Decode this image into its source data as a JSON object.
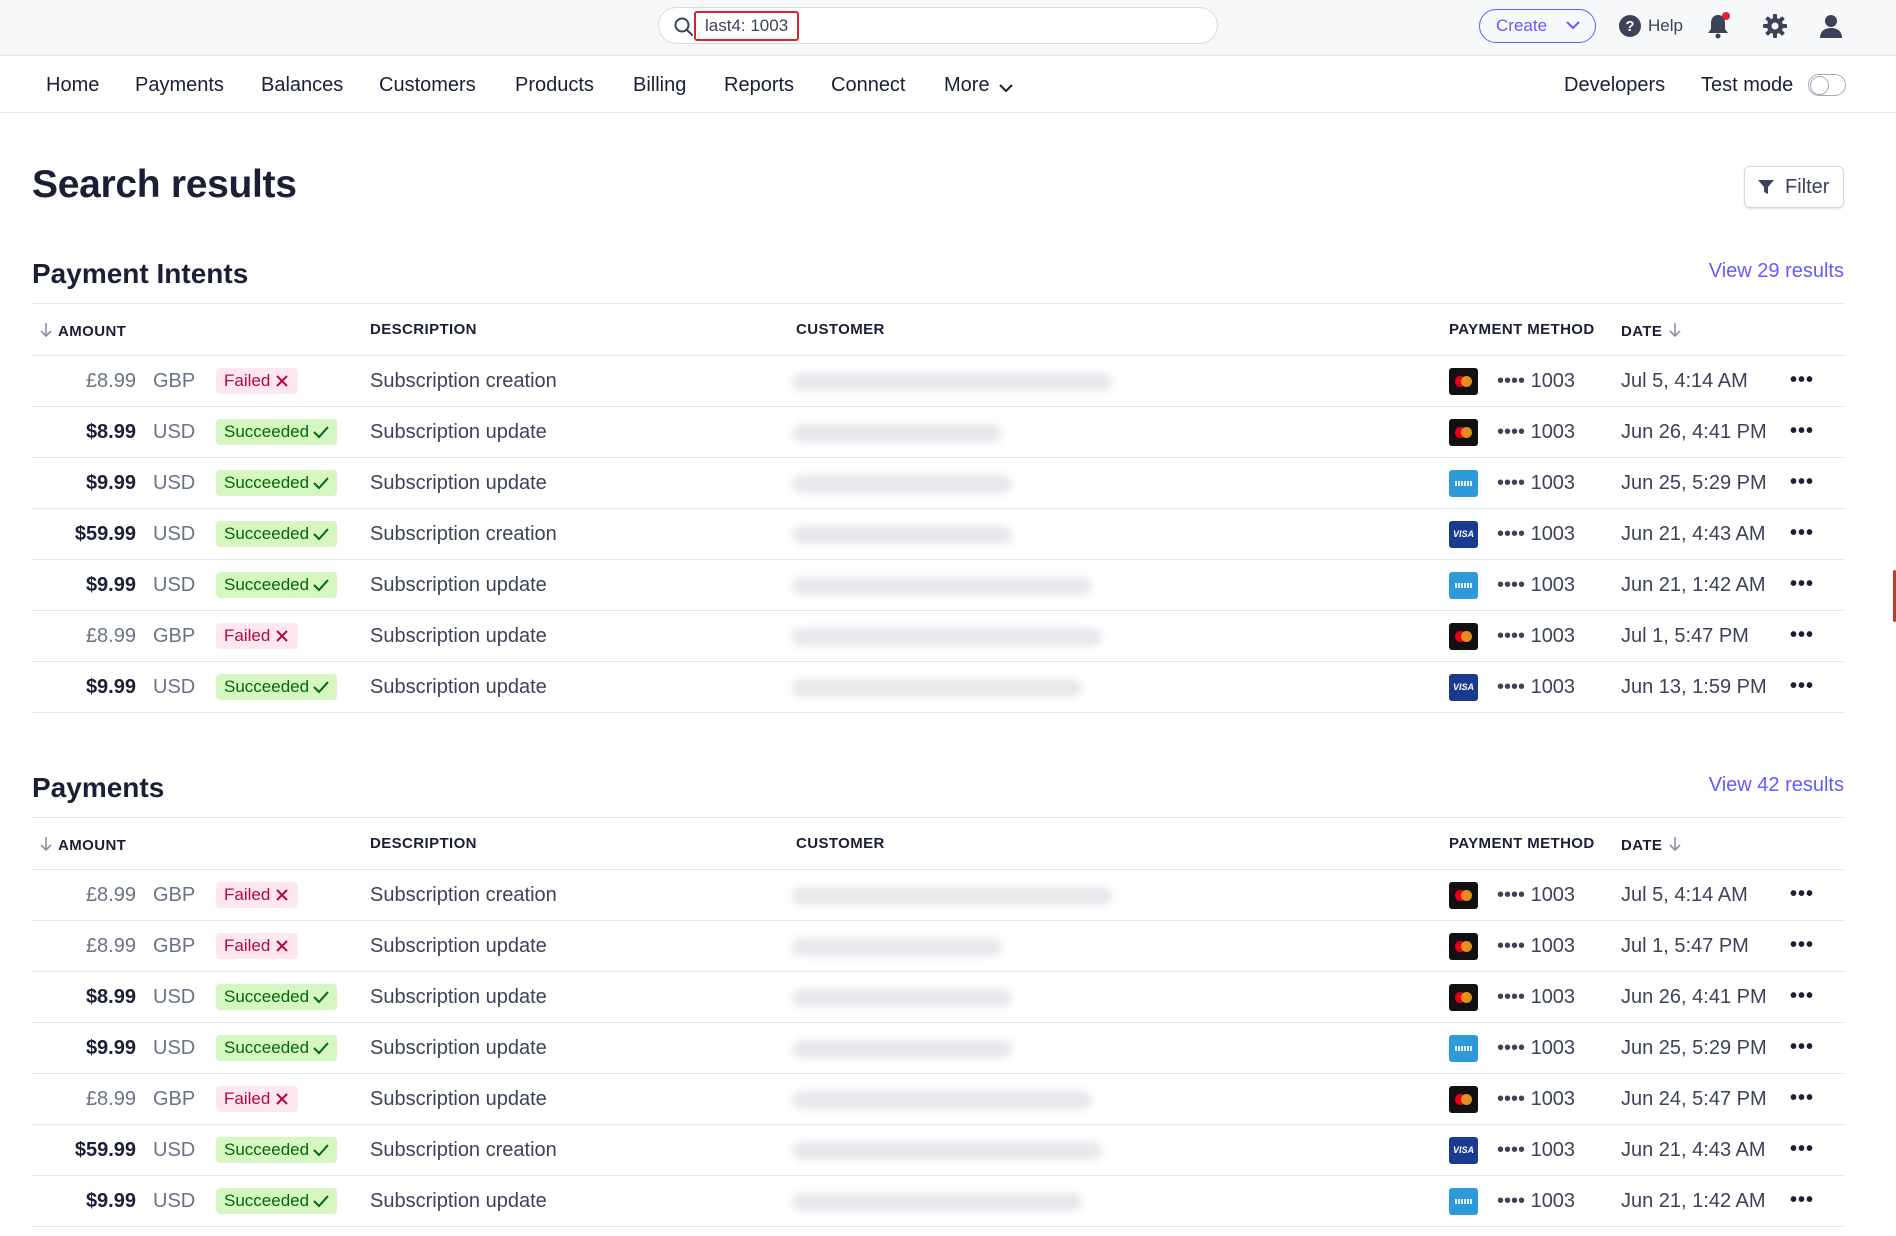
{
  "search": {
    "query": "last4: 1003"
  },
  "topbar": {
    "create_label": "Create",
    "help_label": "Help"
  },
  "nav": {
    "items": [
      "Home",
      "Payments",
      "Balances",
      "Customers",
      "Products",
      "Billing",
      "Reports",
      "Connect",
      "More"
    ],
    "developers": "Developers",
    "test_mode": "Test mode",
    "test_mode_on": false
  },
  "page": {
    "title": "Search results",
    "filter_label": "Filter"
  },
  "columns": {
    "amount": "AMOUNT",
    "description": "DESCRIPTION",
    "customer": "CUSTOMER",
    "payment_method": "PAYMENT METHOD",
    "date": "DATE"
  },
  "payment_intents": {
    "title": "Payment Intents",
    "view_link": "View 29 results",
    "rows": [
      {
        "amount": "£8.99",
        "currency": "GBP",
        "status": "Failed",
        "status_type": "fail",
        "description": "Subscription creation",
        "card": "mastercard",
        "last4": "•••• 1003",
        "date": "Jul 5, 4:14 AM"
      },
      {
        "amount": "$8.99",
        "currency": "USD",
        "status": "Succeeded",
        "status_type": "succ",
        "description": "Subscription update",
        "card": "mastercard",
        "last4": "•••• 1003",
        "date": "Jun 26, 4:41 PM"
      },
      {
        "amount": "$9.99",
        "currency": "USD",
        "status": "Succeeded",
        "status_type": "succ",
        "description": "Subscription update",
        "card": "amex",
        "last4": "•••• 1003",
        "date": "Jun 25, 5:29 PM"
      },
      {
        "amount": "$59.99",
        "currency": "USD",
        "status": "Succeeded",
        "status_type": "succ",
        "description": "Subscription creation",
        "card": "visa",
        "last4": "•••• 1003",
        "date": "Jun 21, 4:43 AM"
      },
      {
        "amount": "$9.99",
        "currency": "USD",
        "status": "Succeeded",
        "status_type": "succ",
        "description": "Subscription update",
        "card": "amex",
        "last4": "•••• 1003",
        "date": "Jun 21, 1:42 AM"
      },
      {
        "amount": "£8.99",
        "currency": "GBP",
        "status": "Failed",
        "status_type": "fail",
        "description": "Subscription update",
        "card": "mastercard",
        "last4": "•••• 1003",
        "date": "Jul 1, 5:47 PM"
      },
      {
        "amount": "$9.99",
        "currency": "USD",
        "status": "Succeeded",
        "status_type": "succ",
        "description": "Subscription update",
        "card": "visa",
        "last4": "•••• 1003",
        "date": "Jun 13, 1:59 PM"
      }
    ]
  },
  "payments": {
    "title": "Payments",
    "view_link": "View 42 results",
    "rows": [
      {
        "amount": "£8.99",
        "currency": "GBP",
        "status": "Failed",
        "status_type": "fail",
        "description": "Subscription creation",
        "card": "mastercard",
        "last4": "•••• 1003",
        "date": "Jul 5, 4:14 AM"
      },
      {
        "amount": "£8.99",
        "currency": "GBP",
        "status": "Failed",
        "status_type": "fail",
        "description": "Subscription update",
        "card": "mastercard",
        "last4": "•••• 1003",
        "date": "Jul 1, 5:47 PM"
      },
      {
        "amount": "$8.99",
        "currency": "USD",
        "status": "Succeeded",
        "status_type": "succ",
        "description": "Subscription update",
        "card": "mastercard",
        "last4": "•••• 1003",
        "date": "Jun 26, 4:41 PM"
      },
      {
        "amount": "$9.99",
        "currency": "USD",
        "status": "Succeeded",
        "status_type": "succ",
        "description": "Subscription update",
        "card": "amex",
        "last4": "•••• 1003",
        "date": "Jun 25, 5:29 PM"
      },
      {
        "amount": "£8.99",
        "currency": "GBP",
        "status": "Failed",
        "status_type": "fail",
        "description": "Subscription update",
        "card": "mastercard",
        "last4": "•••• 1003",
        "date": "Jun 24, 5:47 PM"
      },
      {
        "amount": "$59.99",
        "currency": "USD",
        "status": "Succeeded",
        "status_type": "succ",
        "description": "Subscription creation",
        "card": "visa",
        "last4": "•••• 1003",
        "date": "Jun 21, 4:43 AM"
      },
      {
        "amount": "$9.99",
        "currency": "USD",
        "status": "Succeeded",
        "status_type": "succ",
        "description": "Subscription update",
        "card": "amex",
        "last4": "•••• 1003",
        "date": "Jun 21, 1:42 AM"
      }
    ]
  },
  "colors": {
    "accent": "#635bff",
    "success_bg": "#d7f7c2",
    "success_fg": "#006908",
    "fail_bg": "#ffe7f2",
    "fail_fg": "#b3093c",
    "highlight": "#e0202c"
  }
}
